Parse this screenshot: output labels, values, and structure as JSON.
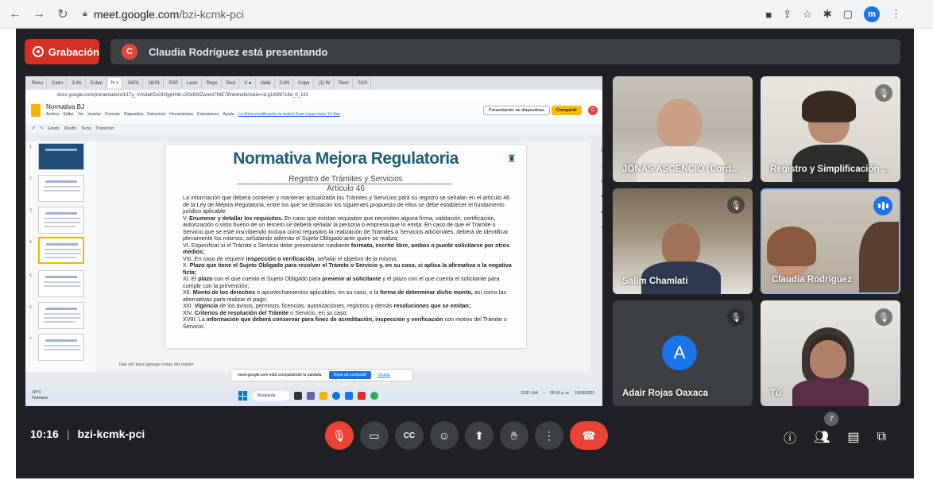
{
  "browser": {
    "url_host": "meet.google.com",
    "url_path": "/bzi-kcmk-pci",
    "profile_initial": "m"
  },
  "meet": {
    "recording_label": "Grabación",
    "presenter_initial": "C",
    "presenting_text": "Claudia Rodríguez está presentando",
    "time": "10:16",
    "meeting_code": "bzi-kcmk-pci",
    "participant_count": "7"
  },
  "shared_screen": {
    "tabs": [
      "Resu",
      "Camı",
      "3.Wı",
      "Estac",
      "N ×",
      "18/01",
      "16/01",
      "SSP",
      "Lean",
      "Reyo",
      "Sesi",
      "V ●",
      "Valid",
      "CAN",
      "Cope",
      "(1) W",
      "Retır",
      "02/0"
    ],
    "url": "docs.google.com/presentation/d/17y_nVkdaK5sOh3jgHHlli-r2GkBMZworkl7lNE7Bn64/edit#slide=id.g180f87c4d_0_191",
    "doc_title": "Normativa BJ",
    "menu": [
      "Archivo",
      "Editar",
      "Ver",
      "Insertar",
      "Formato",
      "Diapositiva",
      "Estructura",
      "Herramientas",
      "Extensiones",
      "Ayuda"
    ],
    "last_edit": "La última modificación la realizó Evan López hace 13 días",
    "present_label": "Presentación de diapositivas",
    "share_label": "Compartir",
    "user_initial": "C",
    "toolbar_items": [
      "Fondo",
      "Diseño",
      "Tema",
      "Transición"
    ],
    "slide": {
      "title": "Normativa Mejora Regulatoria",
      "subtitle": "Registro de Trámites y Servicios",
      "article": "Artículo 46",
      "intro": "La información que deberá contener y mantener actualizada los Trámites y Servicios para su registro se señalan en el artículo 46 de la Ley de Mejora Regulatoria, entre los que se destacan los siguientes propuesto de ellos se debe establecer el fundamento jurídico aplicable:",
      "items": [
        {
          "n": "V.",
          "b1": "Enumerar y detallar los requisitos.",
          "t": " En caso que existan requisitos que necesiten alguna firma, validación, certificación, autorización o visto bueno de un tercero se deberá señalar la persona o empresa que lo emita. En caso de que el Trámite o Servicio que se esté inscribiendo incluya como requisitos la realización de Trámites o Servicios adicionales, deberá de identificar plenamente los mismos, señalando además el Sujeto Obligado ante quien se realiza;"
        },
        {
          "n": "VI.",
          "b1": "",
          "t": "Especificar si el Trámite o Servicio debe presentarse mediante ",
          "b2": "formato, escrito libre, ambos o puede solicitarse por otros medios;"
        },
        {
          "n": "VIII.",
          "b1": "",
          "t": "En caso de requerir ",
          "b2": "inspección o verificación",
          "t2": ", señalar el objetivo de la misma;"
        },
        {
          "n": "X.",
          "b1": "Plazo que tiene el Sujeto Obligado para resolver el Trámite o Servicio y, en su caso, si aplica la afirmativa o la negativa ficta;",
          "t": ""
        },
        {
          "n": "XI.",
          "b1": "",
          "t": "El ",
          "b2": "plazo",
          "t2": " con el que cuenta el Sujeto Obligado para ",
          "b3": "prevenir al solicitante",
          "t3": " y el plazo con el que cuenta el solicitante para cumplir con la prevención;"
        },
        {
          "n": "XII.",
          "b1": "Monto de los derechos",
          "t": " o aprovechamientos aplicables, en su caso, o la ",
          "b2": "forma de determinar dicho monto,",
          "t2": " así como las alternativas para realizar el pago;"
        },
        {
          "n": "XIII.",
          "b1": "Vigencia",
          "t": " de los avisos, permisos, licencias, autorizaciones, registros y demás ",
          "b2": "resoluciones que se emitan;"
        },
        {
          "n": "XIV.",
          "b1": "Criterios de resolución del Trámite",
          "t": " o Servicio, en su caso;"
        },
        {
          "n": "XVIII.",
          "b1": "",
          "t": "La ",
          "b2": "información que deberá conservar para fines de acreditación, inspección y verificación",
          "t2": " con motivo del Trámite o Servicio."
        }
      ]
    },
    "notes_placeholder": "Haz clic para agregar notas del orador",
    "share_notice": "meet.google.com está compartiendo tu pantalla.",
    "stop_share": "Dejar de compartir",
    "hide": "Ocultar",
    "weather_temp": "18°C",
    "weather_desc": "Nublado",
    "taskbar_search": "Búsqueda",
    "tray_lang": "ESP LAA",
    "tray_time": "09:16 a. m.",
    "tray_date": "15/03/2023"
  },
  "participants": [
    {
      "name": "JONÁS ASCENCIO (Cord...",
      "state": "video"
    },
    {
      "name": "Registro y Simplificación ...",
      "state": "muted"
    },
    {
      "name": "Salim Chamlati",
      "state": "muted"
    },
    {
      "name": "Claudia Rodríguez",
      "state": "speaking"
    },
    {
      "name": "Adair Rojas Oaxaca",
      "initial": "A",
      "state": "muted"
    },
    {
      "name": "Tú",
      "state": "muted"
    }
  ],
  "colors": {
    "meet_bg": "#202124",
    "record_red": "#d93025",
    "slide_title": "#1f5f7a",
    "accent_blue": "#1a73e8"
  }
}
